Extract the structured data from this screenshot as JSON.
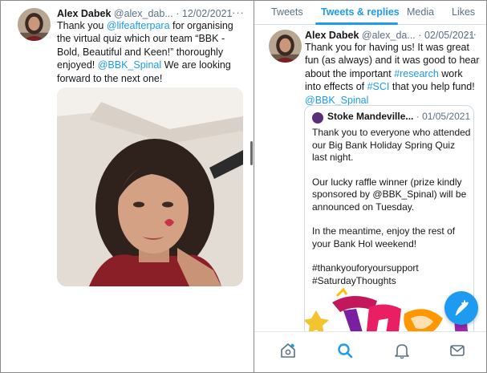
{
  "left_tweet": {
    "author_name": "Alex Dabek",
    "handle": "@alex_dab...",
    "separator": "·",
    "date": "12/02/2021",
    "more": "···",
    "body": [
      {
        "text": "Thank you ",
        "link": false
      },
      {
        "text": "@lifeafterpara",
        "link": true
      },
      {
        "text": " for organising the virtual quiz which our team “BBK - Bold, Beautiful and Keen!” thoroughly enjoyed! ",
        "link": false
      },
      {
        "text": "@BBK_Spinal",
        "link": true
      },
      {
        "text": "  We are looking forward to the next one!",
        "link": false
      }
    ]
  },
  "tabs": [
    {
      "label": "Tweets",
      "active": false
    },
    {
      "label": "Tweets & replies",
      "active": true
    },
    {
      "label": "Media",
      "active": false
    },
    {
      "label": "Likes",
      "active": false
    }
  ],
  "right_tweet": {
    "author_name": "Alex Dabek",
    "handle": "@alex_da...",
    "separator": "·",
    "date": "02/05/2021",
    "more": "···",
    "body": [
      {
        "text": "Thank you for having us! It was great fun (as always) and it was good to hear about the important  ",
        "link": false
      },
      {
        "text": "#research",
        "link": true
      },
      {
        "text": " work into effects of ",
        "link": false
      },
      {
        "text": "#SCI",
        "link": true
      },
      {
        "text": " that you help fund! ",
        "link": false
      },
      {
        "text": "@BBK_Spinal",
        "link": true
      }
    ]
  },
  "quoted_tweet": {
    "author_name": "Stoke Mandeville...",
    "separator": "·",
    "date": "01/05/2021",
    "paragraphs": [
      "Thank you to everyone who attended our Big Bank Holiday Spring Quiz last night.",
      "Our lucky raffle winner (prize kindly sponsored by @BBK_Spinal) will be announced on Tuesday.",
      "In the meantime, enjoy the rest of your Bank Hol weekend!",
      "#thankyouforyoursupport #SaturdayThoughts"
    ]
  },
  "bottom_nav": [
    "home-icon",
    "search-icon",
    "notifications-icon",
    "messages-icon"
  ],
  "colors": {
    "accent": "#1d9bf0",
    "text": "#14171a",
    "muted": "#5b7083"
  }
}
